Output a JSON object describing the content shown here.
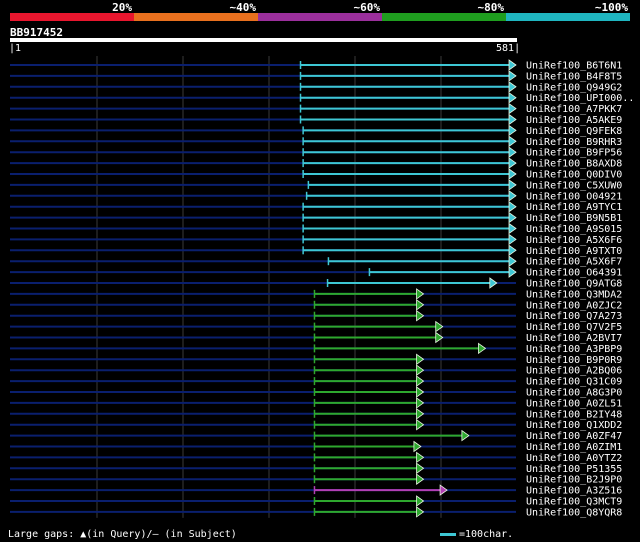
{
  "scale": {
    "labels": [
      "20%",
      "~40%",
      "~60%",
      "~80%",
      "~100%"
    ],
    "colors": [
      "#e8162e",
      "#e8701e",
      "#9b2f9c",
      "#1f9e1f",
      "#1fb5c0"
    ]
  },
  "query": {
    "name": "BB917452",
    "start": "1",
    "end": "581",
    "length": 581
  },
  "hits": [
    {
      "label": "UniRef100_B6T6N1",
      "start": 334,
      "end": 581,
      "tier": 5
    },
    {
      "label": "UniRef100_B4F8T5",
      "start": 334,
      "end": 581,
      "tier": 5
    },
    {
      "label": "UniRef100_Q949G2",
      "start": 334,
      "end": 581,
      "tier": 5
    },
    {
      "label": "UniRef100_UPI000..",
      "start": 334,
      "end": 581,
      "tier": 5
    },
    {
      "label": "UniRef100_A7PKK7",
      "start": 334,
      "end": 581,
      "tier": 5
    },
    {
      "label": "UniRef100_A5AKE9",
      "start": 334,
      "end": 581,
      "tier": 5
    },
    {
      "label": "UniRef100_Q9FEK8",
      "start": 337,
      "end": 581,
      "tier": 5
    },
    {
      "label": "UniRef100_B9RHR3",
      "start": 337,
      "end": 581,
      "tier": 5
    },
    {
      "label": "UniRef100_B9FP56",
      "start": 337,
      "end": 581,
      "tier": 5
    },
    {
      "label": "UniRef100_B8AXD8",
      "start": 337,
      "end": 581,
      "tier": 5
    },
    {
      "label": "UniRef100_Q0DIV0",
      "start": 337,
      "end": 581,
      "tier": 5
    },
    {
      "label": "UniRef100_C5XUW0",
      "start": 343,
      "end": 581,
      "tier": 5
    },
    {
      "label": "UniRef100_O04921",
      "start": 341,
      "end": 581,
      "tier": 5
    },
    {
      "label": "UniRef100_A9TYC1",
      "start": 337,
      "end": 581,
      "tier": 5
    },
    {
      "label": "UniRef100_B9N5B1",
      "start": 337,
      "end": 581,
      "tier": 5
    },
    {
      "label": "UniRef100_A9S015",
      "start": 337,
      "end": 581,
      "tier": 5
    },
    {
      "label": "UniRef100_A5X6F6",
      "start": 337,
      "end": 581,
      "tier": 5
    },
    {
      "label": "UniRef100_A9TXT0",
      "start": 337,
      "end": 581,
      "tier": 5
    },
    {
      "label": "UniRef100_A5X6F7",
      "start": 366,
      "end": 581,
      "tier": 5
    },
    {
      "label": "UniRef100_O64391",
      "start": 413,
      "end": 581,
      "tier": 5
    },
    {
      "label": "UniRef100_Q9ATG8",
      "start": 365,
      "end": 559,
      "tier": 5
    },
    {
      "label": "UniRef100_Q3MDA2",
      "start": 350,
      "end": 475,
      "tier": 4
    },
    {
      "label": "UniRef100_A0ZJC2",
      "start": 350,
      "end": 475,
      "tier": 4
    },
    {
      "label": "UniRef100_Q7A273",
      "start": 350,
      "end": 475,
      "tier": 4
    },
    {
      "label": "UniRef100_Q7V2F5",
      "start": 350,
      "end": 497,
      "tier": 4
    },
    {
      "label": "UniRef100_A2BVI7",
      "start": 350,
      "end": 497,
      "tier": 4
    },
    {
      "label": "UniRef100_A3PBP9",
      "start": 350,
      "end": 546,
      "tier": 4
    },
    {
      "label": "UniRef100_B9P0R9",
      "start": 350,
      "end": 475,
      "tier": 4
    },
    {
      "label": "UniRef100_A2BQ06",
      "start": 350,
      "end": 475,
      "tier": 4
    },
    {
      "label": "UniRef100_Q31C09",
      "start": 350,
      "end": 475,
      "tier": 4
    },
    {
      "label": "UniRef100_A8G3P0",
      "start": 350,
      "end": 475,
      "tier": 4
    },
    {
      "label": "UniRef100_A0ZL51",
      "start": 350,
      "end": 475,
      "tier": 4
    },
    {
      "label": "UniRef100_B2IY48",
      "start": 350,
      "end": 475,
      "tier": 4
    },
    {
      "label": "UniRef100_Q1XDD2",
      "start": 350,
      "end": 475,
      "tier": 4
    },
    {
      "label": "UniRef100_A0ZF47",
      "start": 350,
      "end": 527,
      "tier": 4
    },
    {
      "label": "UniRef100_A0ZIM1",
      "start": 350,
      "end": 472,
      "tier": 4
    },
    {
      "label": "UniRef100_A0YTZ2",
      "start": 350,
      "end": 475,
      "tier": 4
    },
    {
      "label": "UniRef100_P51355",
      "start": 350,
      "end": 475,
      "tier": 4
    },
    {
      "label": "UniRef100_B2J9P0",
      "start": 350,
      "end": 475,
      "tier": 4
    },
    {
      "label": "UniRef100_A3Z516",
      "start": 350,
      "end": 502,
      "tier": 3
    },
    {
      "label": "UniRef100_Q3MCT9",
      "start": 350,
      "end": 475,
      "tier": 4
    },
    {
      "label": "UniRef100_Q8YQR8",
      "start": 350,
      "end": 475,
      "tier": 4
    }
  ],
  "colors": {
    "background": "#000000",
    "grid": "#3a3a3a",
    "query_track": "#0a1f6e",
    "tier3": "#b23fb4",
    "tier4": "#2ea82e",
    "tier5": "#3ec7d4"
  },
  "footer": {
    "legend": "Large gaps: ▲(in Query)/— (in Subject)",
    "key_text": "=100char."
  }
}
